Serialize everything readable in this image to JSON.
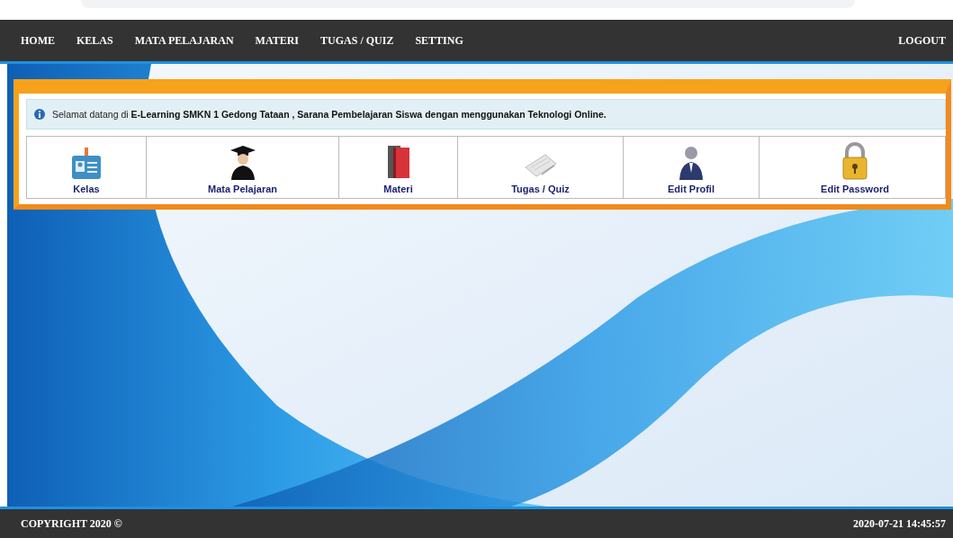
{
  "nav": {
    "items": [
      {
        "label": "HOME"
      },
      {
        "label": "KELAS"
      },
      {
        "label": "MATA PELAJARAN"
      },
      {
        "label": "MATERI"
      },
      {
        "label": "TUGAS / QUIZ"
      },
      {
        "label": "SETTING"
      }
    ],
    "logout": "LOGOUT"
  },
  "info": "Selamat datang di **E-Learning SMKN 1 Gedong Tataan , Sarana Pembelajaran Siswa dengan menggunakan Teknologi Online.**",
  "menu": [
    {
      "kind": "idcard",
      "label": "Kelas"
    },
    {
      "kind": "graduate",
      "label": "Mata Pelajaran"
    },
    {
      "kind": "books",
      "label": "Materi"
    },
    {
      "kind": "paper",
      "label": "Tugas / Quiz"
    },
    {
      "kind": "person",
      "label": "Edit Profil"
    },
    {
      "kind": "lock",
      "label": "Edit Password"
    }
  ],
  "footer": {
    "copyright": "COPYRIGHT 2020 ©",
    "datetime": "2020-07-21 14:45:57"
  }
}
